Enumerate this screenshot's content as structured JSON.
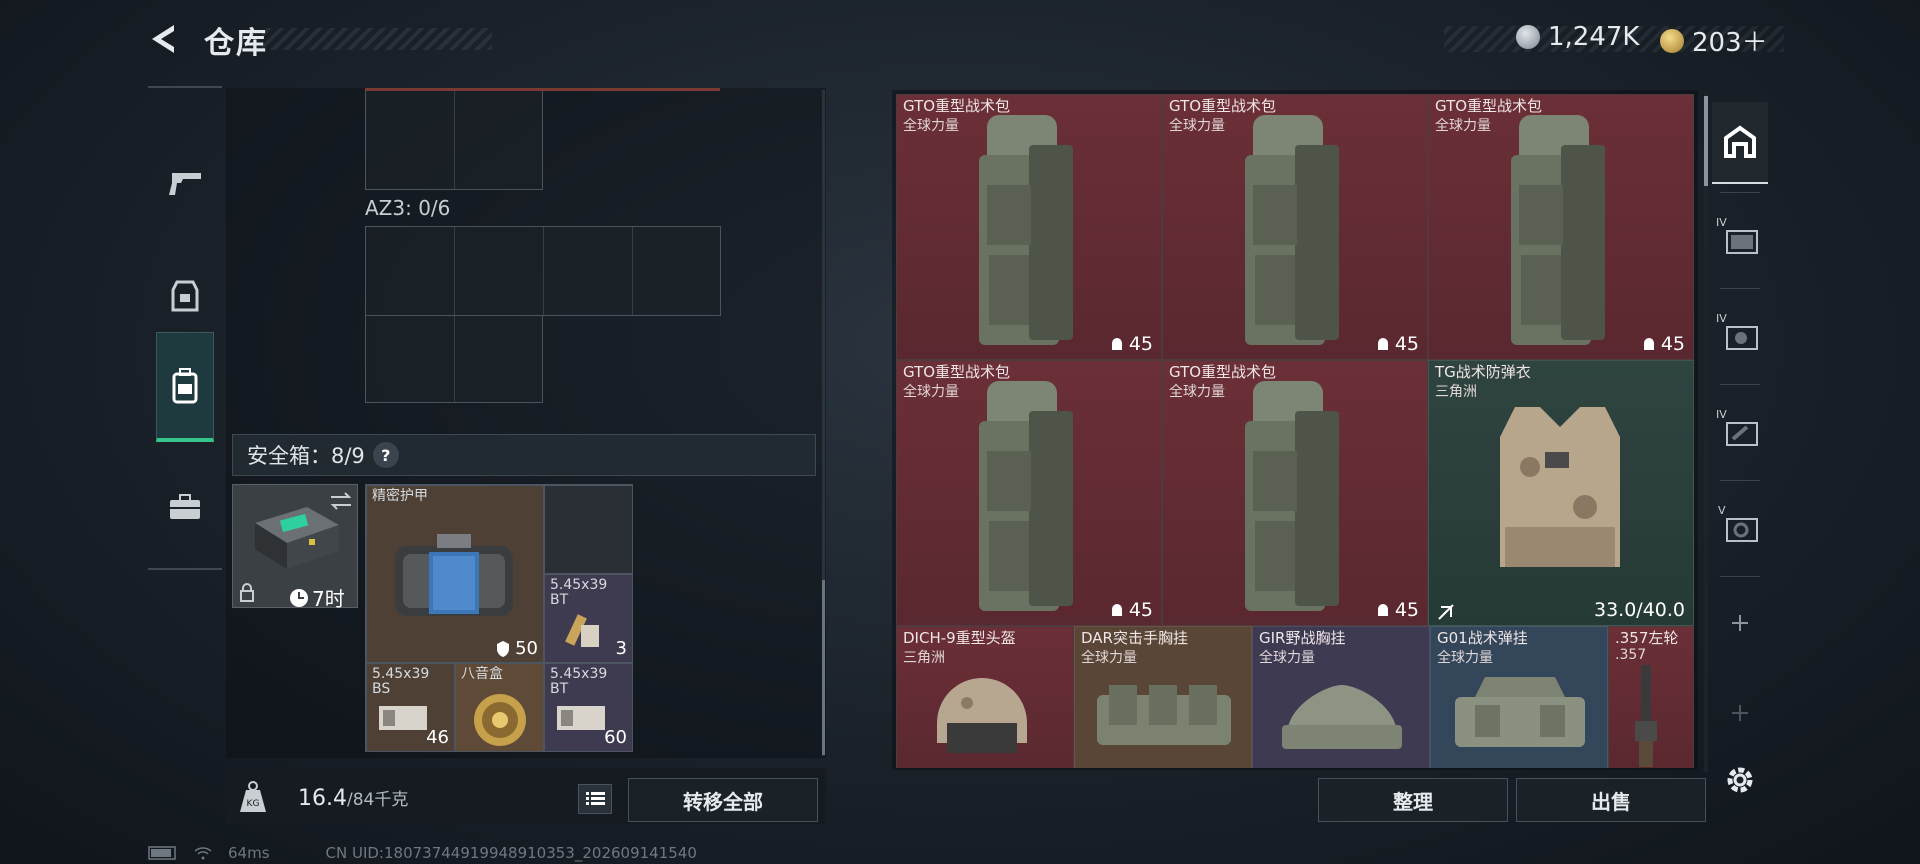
{
  "header": {
    "title": "仓库",
    "currency": [
      {
        "icon": "silver-coin-icon",
        "value": "1,247K",
        "color": "#b9c0c7"
      },
      {
        "icon": "gold-coin-icon",
        "value": "203＋",
        "color": "#d7b45a"
      }
    ]
  },
  "left_nav": [
    {
      "name": "weapons",
      "icon": "pistol-icon"
    },
    {
      "name": "gear",
      "icon": "armor-icon"
    },
    {
      "name": "backpack",
      "icon": "backpack-icon",
      "active": true
    },
    {
      "name": "briefcase",
      "icon": "briefcase-icon"
    }
  ],
  "stash": {
    "az3_label": "AZ3: 0/6",
    "safe_label": "安全箱：8/9",
    "help": "?",
    "case_timer": "7时",
    "items": [
      {
        "name": "精密护甲",
        "count": "50",
        "icon": "shield-icon"
      },
      {
        "name": "5.45x39 BT",
        "count": "3"
      },
      {
        "name": "5.45x39 BS",
        "count": "46"
      },
      {
        "name": "八音盒",
        "count": ""
      },
      {
        "name": "5.45x39 BT",
        "count": "60"
      }
    ]
  },
  "weight": {
    "current": "16.4",
    "max": "/84千克",
    "icon": "weight-icon"
  },
  "buttons": {
    "transfer_all": "转移全部",
    "sort": "整理",
    "sell": "出售"
  },
  "inventory": {
    "rows": [
      [
        {
          "name": "GTO重型战术包",
          "sub": "全球力量",
          "dura": "45",
          "color": "red"
        },
        {
          "name": "GTO重型战术包",
          "sub": "全球力量",
          "dura": "45",
          "color": "red"
        },
        {
          "name": "GTO重型战术包",
          "sub": "全球力量",
          "dura": "45",
          "color": "red"
        }
      ],
      [
        {
          "name": "GTO重型战术包",
          "sub": "全球力量",
          "dura": "45",
          "color": "red"
        },
        {
          "name": "GTO重型战术包",
          "sub": "全球力量",
          "dura": "45",
          "color": "red"
        },
        {
          "name": "TG战术防弹衣",
          "sub": "三角洲",
          "dura": "33.0/40.0",
          "color": "green"
        }
      ],
      [
        {
          "name": "DICH-9重型头盔",
          "sub": "三角洲",
          "color": "red"
        },
        {
          "name": "DAR突击手胸挂",
          "sub": "全球力量",
          "color": "brown"
        },
        {
          "name": "GIR野战胸挂",
          "sub": "全球力量",
          "color": "purple"
        },
        {
          "name": "G01战术弹挂",
          "sub": "全球力量",
          "color": "blue"
        },
        {
          "name": ".357左轮",
          "sub": ".357",
          "color": "red"
        }
      ]
    ]
  },
  "side_tabs": [
    {
      "icon": "home-icon",
      "active": true
    },
    {
      "icon": "iv-case-icon",
      "label": "IV"
    },
    {
      "icon": "iv-key-icon",
      "label": "IV"
    },
    {
      "icon": "iv-tool-icon",
      "label": "IV"
    },
    {
      "icon": "v-key-icon",
      "label": "V"
    },
    {
      "icon": "plus-icon"
    },
    {
      "icon": "plus-icon"
    }
  ],
  "status": {
    "ping": "64ms",
    "uid": "CN UID:18073744919948910353_202609141540"
  },
  "colors": {
    "accent_green": "#35c48a",
    "rare_red": "#6b2f37"
  }
}
